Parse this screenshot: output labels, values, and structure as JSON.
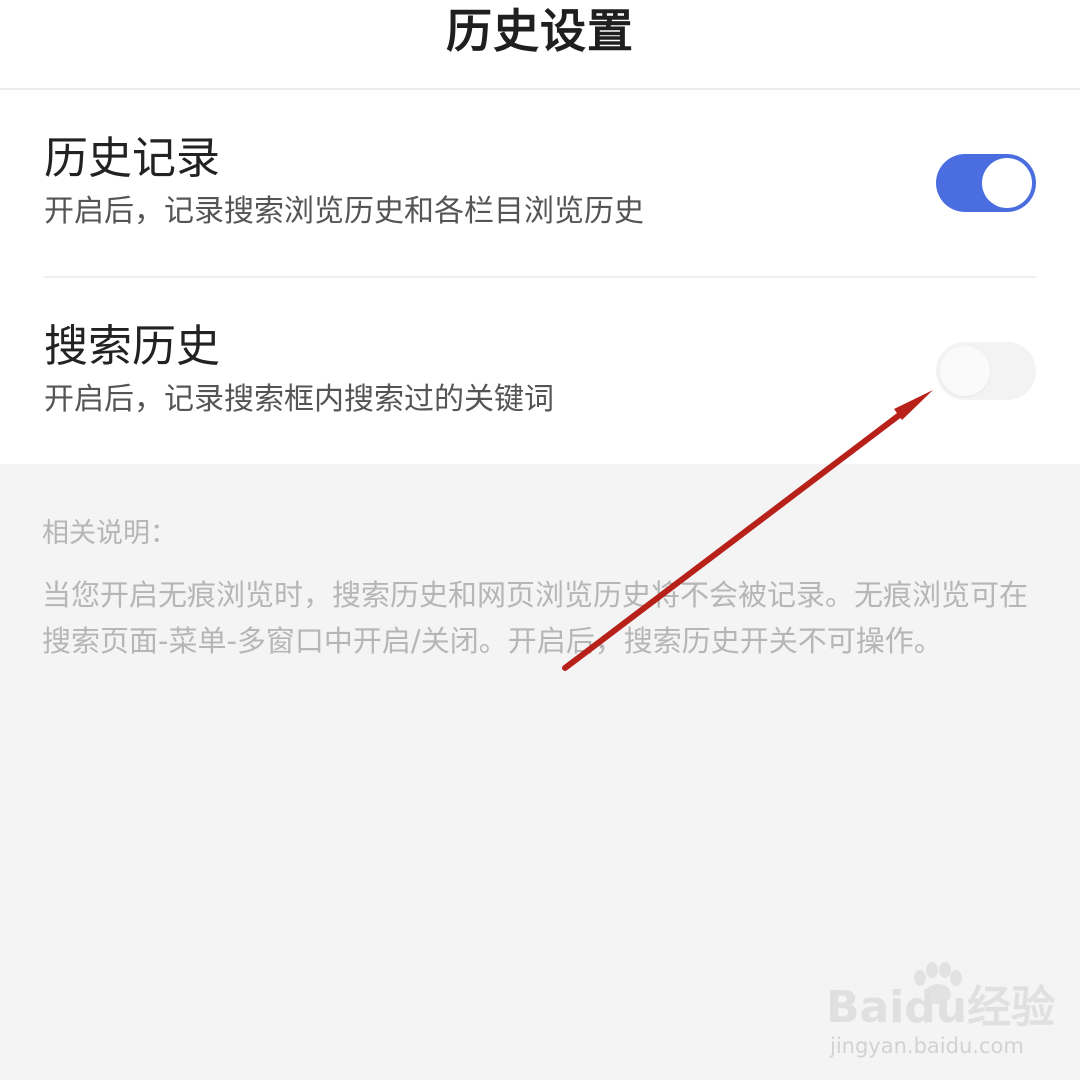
{
  "header": {
    "title": "历史设置"
  },
  "settings": [
    {
      "title": "历史记录",
      "description": "开启后，记录搜索浏览历史和各栏目浏览历史",
      "enabled": true
    },
    {
      "title": "搜索历史",
      "description": "开启后，记录搜索框内搜索过的关键词",
      "enabled": false
    }
  ],
  "notes": {
    "title": "相关说明：",
    "body": "当您开启无痕浏览时，搜索历史和网页浏览历史将不会被记录。无痕浏览可在搜索页面-菜单-多窗口中开启/关闭。开启后，搜索历史开关不可操作。"
  },
  "watermark": {
    "logo": "Baidu经验",
    "url": "jingyan.baidu.com"
  },
  "colors": {
    "toggle_on": "#4a6ee0",
    "toggle_off": "#f3f3f3",
    "annotation_arrow": "#b8201a",
    "background": "#f4f4f4"
  },
  "icons": {
    "annotation": "arrow-icon",
    "watermark": "paw-icon"
  }
}
